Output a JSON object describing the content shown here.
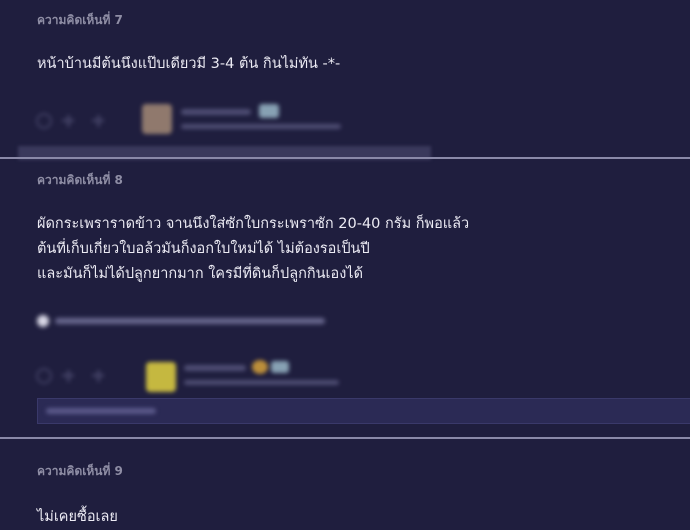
{
  "comments": [
    {
      "label": "ความคิดเห็นที่ 7",
      "lines": [
        "หน้าบ้านมีต้นนึงแป๊บเดียวมี 3-4 ต้น กินไม่ทัน -*-"
      ]
    },
    {
      "label": "ความคิดเห็นที่ 8",
      "lines": [
        "ผัดกระเพราราดข้าว จานนึงใส่ซักใบกระเพราซัก 20-40 กรัม ก็พอแล้ว",
        "ต้นที่เก็บเกี่ยวใบอล้วมันก็งอกใบใหม่ได้ ไม่ต้องรอเป็นปี",
        "และมันก็ไม่ได้ปลูกยากมาก ใครมีที่ดินก็ปลูกกินเองได้"
      ]
    },
    {
      "label": "ความคิดเห็นที่ 9",
      "lines": [
        "ไม่เคยซื้อเลย"
      ]
    }
  ],
  "colors": {
    "background": "#1f1e3e",
    "divider": "#8a89a8",
    "label": "#8f8ea5",
    "text": "#ecebf4"
  },
  "icons": [
    "vote-icon",
    "plus-icon",
    "emoji-icon",
    "avatar"
  ]
}
